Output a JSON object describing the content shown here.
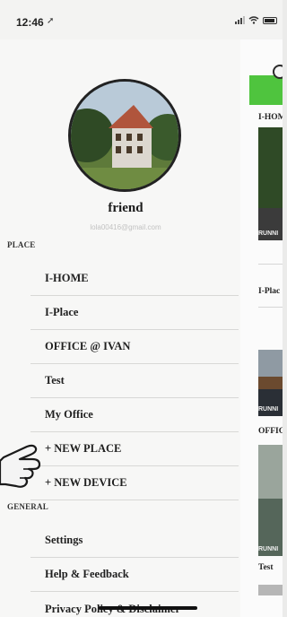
{
  "status": {
    "time": "12:46"
  },
  "profile": {
    "name": "friend",
    "email": "lola00416@gmail.com"
  },
  "sections": {
    "place": "PLACE",
    "general": "GENERAL"
  },
  "place_items": [
    "I-HOME",
    "I-Place",
    "OFFICE @ IVAN",
    "Test",
    "My Office",
    "+ NEW PLACE",
    "+ NEW DEVICE"
  ],
  "general_items": [
    "Settings",
    "Help & Feedback",
    "Privacy Policy & Disclaimer"
  ],
  "content": {
    "cards": [
      {
        "label": "I-HOM",
        "status": "RUNNI"
      },
      {
        "label": "I-Plac",
        "status": ""
      },
      {
        "label": "",
        "status": "RUNNI"
      },
      {
        "label": "OFFIC",
        "status": "RUNNI"
      },
      {
        "label": "Test",
        "status": ""
      }
    ]
  },
  "colors": {
    "accent_green": "#4fc43e",
    "sidebar_bg": "#f7f7f6"
  },
  "icons": [
    "location-arrow-icon",
    "signal-icon",
    "wifi-icon",
    "battery-icon",
    "pointing-hand-icon",
    "avatar-house-photo"
  ]
}
